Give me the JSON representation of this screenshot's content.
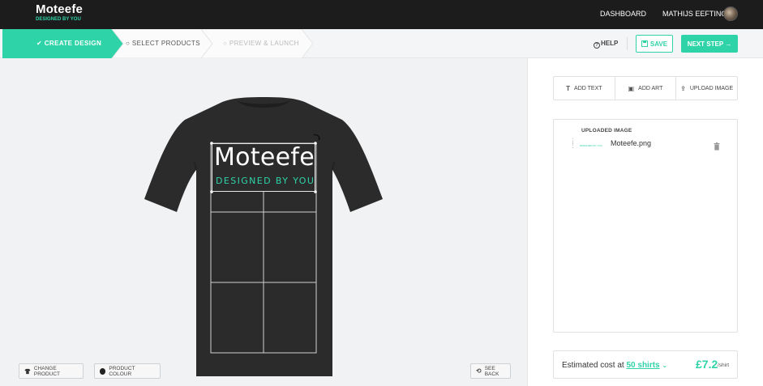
{
  "header": {
    "logo_title": "Moteefe",
    "logo_subtitle": "DESIGNED BY YOU",
    "nav_dashboard": "DASHBOARD",
    "user_name": "MATHIJS EEFTING"
  },
  "steps": [
    {
      "label": "✔ CREATE DESIGN",
      "state": "active"
    },
    {
      "label": "○ SELECT PRODUCTS",
      "state": "pending"
    },
    {
      "label": "○ PREVIEW & LAUNCH",
      "state": "disabled"
    }
  ],
  "toolbar": {
    "help_label": "HELP",
    "save_label": "SAVE",
    "next_label": "NEXT STEP →"
  },
  "design": {
    "print_title": "Moteefe",
    "print_subtitle": "DESIGNED BY YOU",
    "shirt_color": "#2b2b2b"
  },
  "canvas_buttons": {
    "change_product": "CHANGE PRODUCT",
    "product_colour": "PRODUCT COLOUR",
    "see_back": "SEE BACK"
  },
  "tools": [
    {
      "icon": "T",
      "label": "ADD TEXT"
    },
    {
      "icon": "▣",
      "label": "ADD ART"
    },
    {
      "icon": "⇪",
      "label": "UPLOAD IMAGE"
    }
  ],
  "layers": {
    "title": "UPLOADED IMAGE",
    "thumb_text": "DESIGNED BY YOU",
    "file_name": "Moteefe.png"
  },
  "cost": {
    "label": "Estimated cost at",
    "quantity": "50 shirts",
    "price": "£7.2",
    "unit": "/shirt"
  },
  "colors": {
    "accent": "#2fd3a8",
    "topbar": "#1c1c1c"
  }
}
